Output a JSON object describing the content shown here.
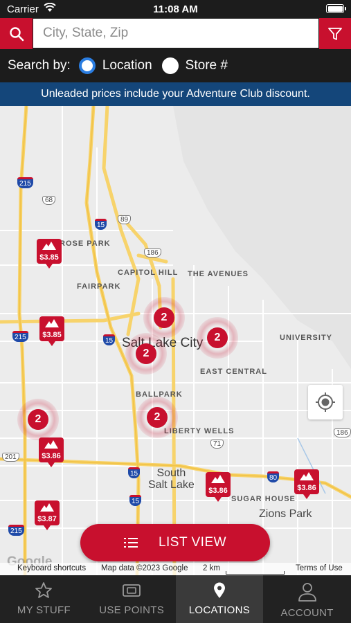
{
  "status_bar": {
    "carrier": "Carrier",
    "time": "11:08 AM"
  },
  "search": {
    "placeholder": "City, State, Zip",
    "value": ""
  },
  "search_by": {
    "label": "Search by:",
    "options": [
      {
        "label": "Location",
        "selected": true
      },
      {
        "label": "Store #",
        "selected": false
      }
    ]
  },
  "banner": {
    "text": "Unleaded prices include your Adventure Club discount."
  },
  "map": {
    "neighborhoods": [
      "ROSE PARK",
      "CAPITOL HILL",
      "THE AVENUES",
      "FAIRPARK",
      "UNIVERSITY",
      "EAST CENTRAL",
      "BALLPARK",
      "LIBERTY WELLS",
      "SUGAR HOUSE"
    ],
    "city": "Salt Lake City",
    "areas": [
      "South\nSalt Lake",
      "Zions Park"
    ],
    "shields": [
      "215",
      "68",
      "89",
      "15",
      "186",
      "215",
      "15",
      "71",
      "201",
      "15",
      "15",
      "80",
      "186",
      "215"
    ],
    "price_pins": [
      "$3.85",
      "$3.85",
      "$3.86",
      "$3.86",
      "$3.86",
      "$3.87"
    ],
    "clusters": [
      "2",
      "2",
      "2",
      "2",
      "2"
    ],
    "google": "Google",
    "attribution": {
      "shortcuts": "Keyboard shortcuts",
      "map_data": "Map data ©2023 Google",
      "scale": "2 km",
      "terms": "Terms of Use"
    }
  },
  "list_view_button": "LIST VIEW",
  "tabs": [
    {
      "label": "MY STUFF",
      "icon": "star-icon",
      "active": false
    },
    {
      "label": "USE POINTS",
      "icon": "ticket-icon",
      "active": false
    },
    {
      "label": "LOCATIONS",
      "icon": "location-pin-icon",
      "active": true
    },
    {
      "label": "ACCOUNT",
      "icon": "person-icon",
      "active": false
    }
  ],
  "colors": {
    "brand_red": "#c8102e",
    "banner_blue": "#14467a",
    "radio_blue": "#2a7de1",
    "dark_bg": "#1c1c1c"
  }
}
